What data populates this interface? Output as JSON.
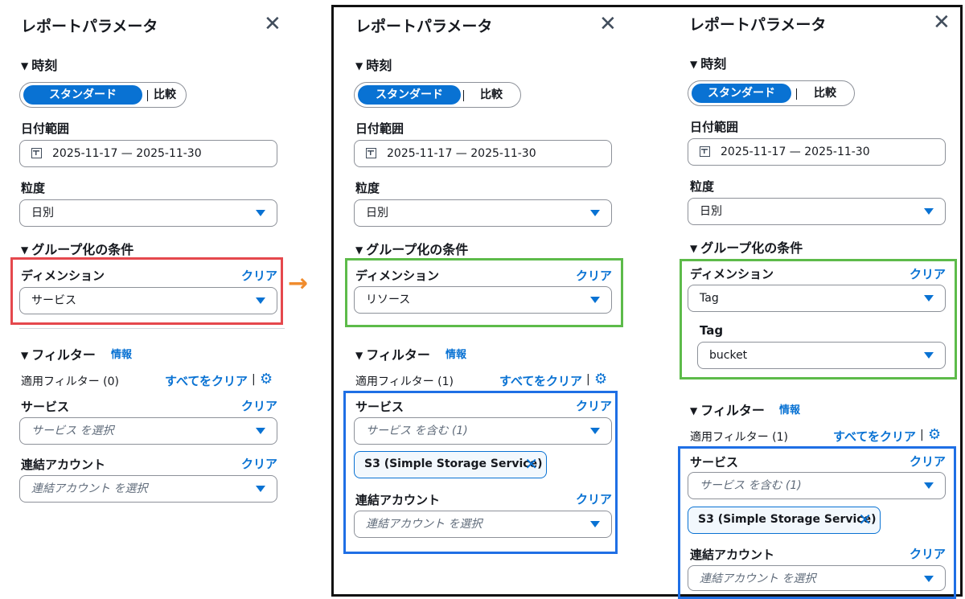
{
  "common": {
    "panel_title": "レポートパラメータ",
    "close_glyph": "✕",
    "time_section": "時刻",
    "seg_standard": "スタンダード",
    "seg_compare": "比較",
    "date_range_label": "日付範囲",
    "date_range_value": "2025-11-17 — 2025-11-30",
    "granularity_label": "粒度",
    "granularity_value": "日別",
    "group_section": "グループ化の条件",
    "dimension_label": "ディメンション",
    "clear": "クリア",
    "filter_section": "フィルター",
    "info": "情報",
    "clear_all": "すべてをクリア",
    "service_label": "サービス",
    "linked_account_label": "連結アカウント",
    "linked_account_placeholder": "連結アカウント を選択",
    "separator": "|",
    "arrow": "→"
  },
  "panel1": {
    "dimension_value": "サービス",
    "applied_filters": "適用フィルター (0)",
    "service_placeholder": "サービス を選択"
  },
  "panel2": {
    "dimension_value": "リソース",
    "applied_filters": "適用フィルター (1)",
    "service_value": "サービス を含む (1)",
    "chip_label": "S3 (Simple Storage Service)"
  },
  "panel3": {
    "dimension_value": "Tag",
    "tag_label": "Tag",
    "tag_value": "bucket",
    "applied_filters": "適用フィルター (1)",
    "service_value": "サービス を含む (1)",
    "chip_label": "S3 (Simple Storage Service)"
  },
  "colors": {
    "accent": "#0972d3",
    "highlight_red": "#e5484d",
    "highlight_green": "#5dbb4a",
    "highlight_blue": "#1f6fe5",
    "arrow_orange": "#f08c2e"
  }
}
